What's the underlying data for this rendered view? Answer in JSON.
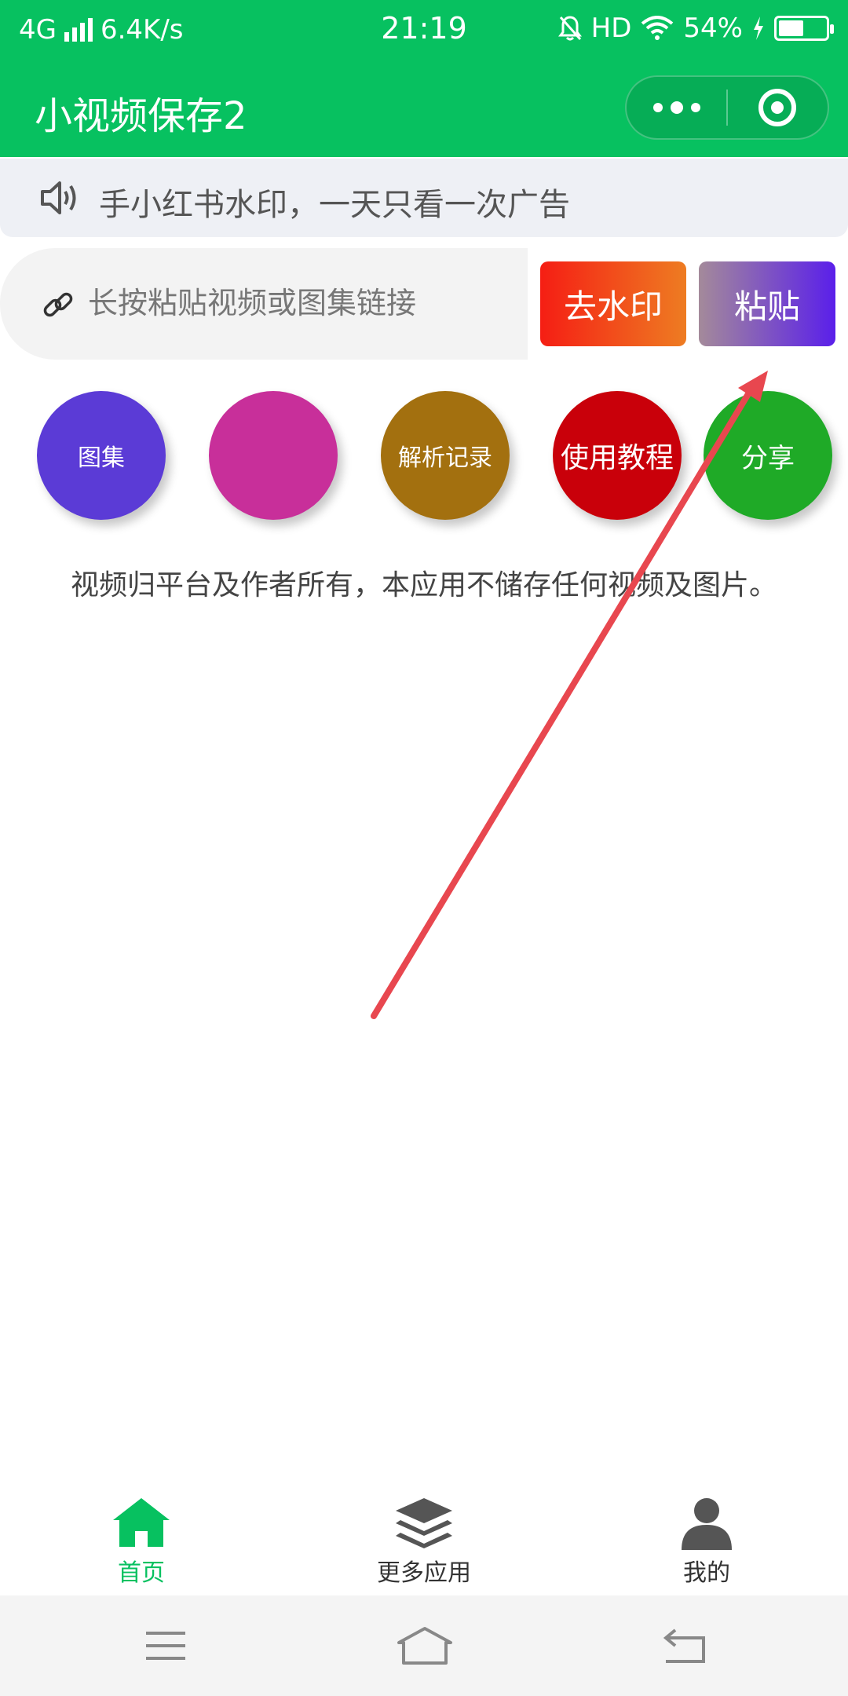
{
  "status_bar": {
    "network": "4G",
    "speed": "6.4K/s",
    "time": "21:19",
    "hd": "HD",
    "battery": "54%",
    "battery_level": 0.54
  },
  "nav": {
    "title": "小视频保存2",
    "more_icon": "more-dots-icon",
    "close_icon": "target-ring-icon"
  },
  "notice": {
    "icon": "speaker-icon",
    "text": "手小红书水印，一天只看一次广告"
  },
  "link_input": {
    "icon": "link-icon",
    "placeholder": "长按粘贴视频或图集链接",
    "value": ""
  },
  "buttons": {
    "remove_watermark": "去水印",
    "paste": "粘贴"
  },
  "quick_actions": [
    {
      "label": "图集",
      "color": "#5b3bd6"
    },
    {
      "label": "",
      "color": "#c82f9a"
    },
    {
      "label": "解析记录",
      "color": "#a3700f"
    },
    {
      "label": "使用教程",
      "color": "#c9000a"
    },
    {
      "label": "分享",
      "color": "#1faa27"
    }
  ],
  "disclaimer": "视频归平台及作者所有，本应用不储存任何视频及图片。",
  "tabbar": {
    "items": [
      {
        "label": "首页",
        "icon": "home-icon",
        "active": true
      },
      {
        "label": "更多应用",
        "icon": "layers-icon",
        "active": false
      },
      {
        "label": "我的",
        "icon": "user-icon",
        "active": false
      }
    ]
  },
  "colors": {
    "brand": "#07c160",
    "annotation_arrow": "#e8474f"
  },
  "system_nav": {
    "menu_icon": "menu-icon",
    "home_icon": "system-home-icon",
    "back_icon": "back-icon"
  }
}
